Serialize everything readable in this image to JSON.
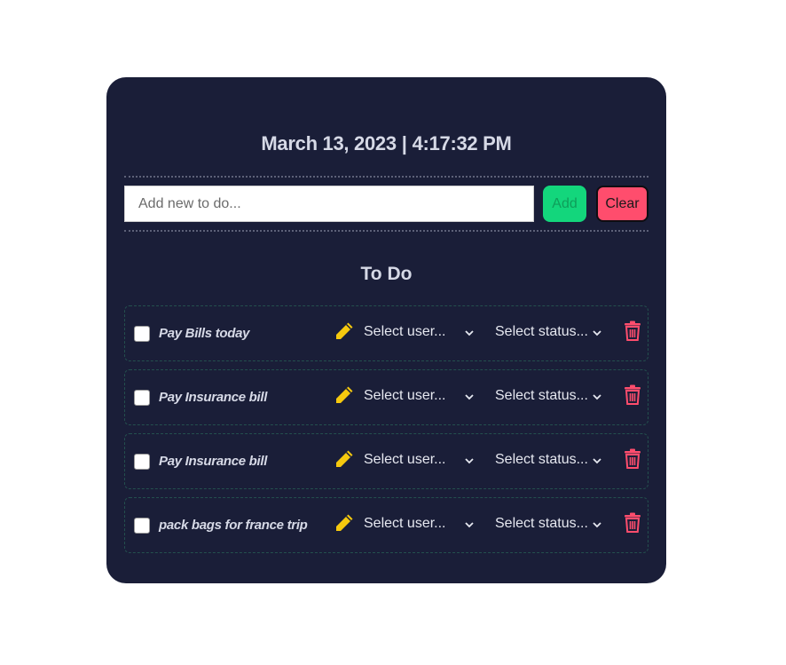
{
  "header": {
    "date": "March 13, 2023",
    "separator": "|",
    "time": "4:17:32 PM"
  },
  "input": {
    "placeholder": "Add new to do...",
    "value": ""
  },
  "buttons": {
    "add": "Add",
    "clear": "Clear"
  },
  "section_title": "To Do",
  "todos": [
    {
      "text": "Pay Bills today",
      "checked": false,
      "user_select": "Select user...",
      "status_select": "Select status..."
    },
    {
      "text": "Pay Insurance bill",
      "checked": false,
      "user_select": "Select user...",
      "status_select": "Select status..."
    },
    {
      "text": "Pay Insurance bill",
      "checked": false,
      "user_select": "Select user...",
      "status_select": "Select status..."
    },
    {
      "text": "pack bags for france trip",
      "checked": false,
      "user_select": "Select user...",
      "status_select": "Select status..."
    }
  ],
  "icons": {
    "edit": "pencil-icon",
    "delete": "trash-icon",
    "dropdown": "chevron-down-icon"
  },
  "colors": {
    "card_bg": "#1a1e38",
    "add": "#13d67c",
    "clear": "#ff4d6d",
    "pencil": "#f6c90e",
    "trash": "#ff4d6d"
  }
}
